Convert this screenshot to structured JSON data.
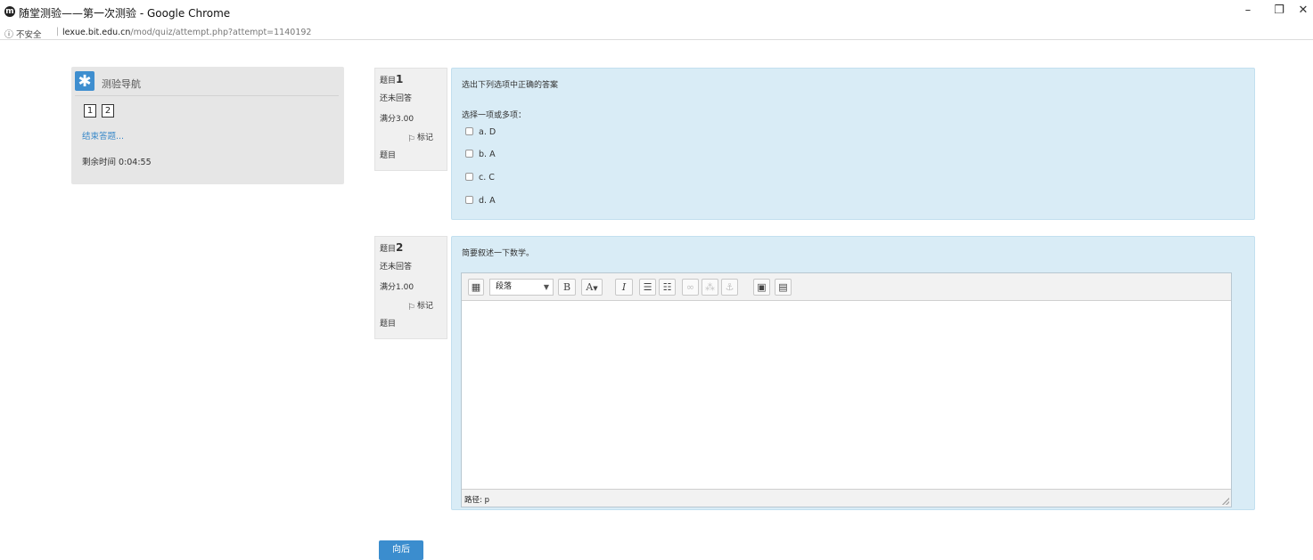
{
  "window": {
    "app_icon": "moodle-icon",
    "title": "随堂测验——第一次测验 - Google Chrome",
    "minimize": "–",
    "maximize": "❐",
    "close": "✕"
  },
  "address": {
    "info_icon": "ⓘ",
    "insecure_label": "不安全",
    "separator": "|",
    "host": "lexue.bit.edu.cn",
    "path": "/mod/quiz/attempt.php?attempt=1140192"
  },
  "nav": {
    "icon": "asterisk-icon",
    "title": "测验导航",
    "questions": [
      "1",
      "2"
    ],
    "finish_link": "结束答题...",
    "timer": "剩余时间 0:04:55"
  },
  "q1": {
    "label": "题目",
    "number": "1",
    "state": "还未回答",
    "grade": "满分3.00",
    "flag_label": "标记",
    "flag_label2": "题目",
    "text": "选出下列选项中正确的答案",
    "prompt": "选择一项或多项：",
    "options": [
      "a. D",
      "b. A",
      "c. C",
      "d. A"
    ]
  },
  "q2": {
    "label": "题目",
    "number": "2",
    "state": "还未回答",
    "grade": "满分1.00",
    "flag_label": "标记",
    "flag_label2": "题目",
    "text": "简要叙述一下数学。",
    "editor": {
      "format_select": "段落",
      "bold": "B",
      "font_color": "A",
      "italic": "I",
      "path_label": "路径: p"
    }
  },
  "next_button": "向后",
  "colors": {
    "accent": "#3b8dce",
    "question_bg": "#d9ecf6",
    "nav_bg": "#e6e6e6"
  }
}
